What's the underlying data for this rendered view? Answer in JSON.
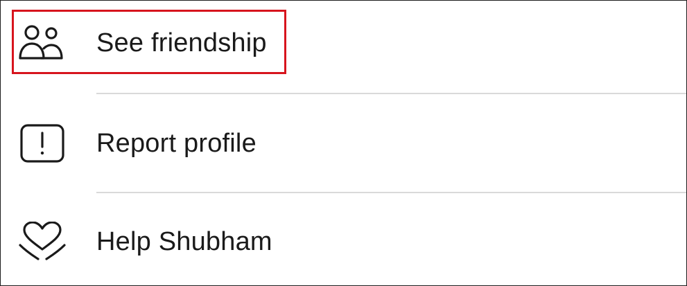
{
  "menu": {
    "items": [
      {
        "label": "See friendship",
        "icon": "friends-icon",
        "highlighted": true
      },
      {
        "label": "Report profile",
        "icon": "report-exclamation-icon",
        "highlighted": false
      },
      {
        "label": "Help Shubham",
        "icon": "heart-hands-icon",
        "highlighted": false
      }
    ]
  },
  "colors": {
    "highlight": "#d7141d",
    "text": "#1a1a1a",
    "divider": "#d9d9d9",
    "background": "#ffffff"
  }
}
